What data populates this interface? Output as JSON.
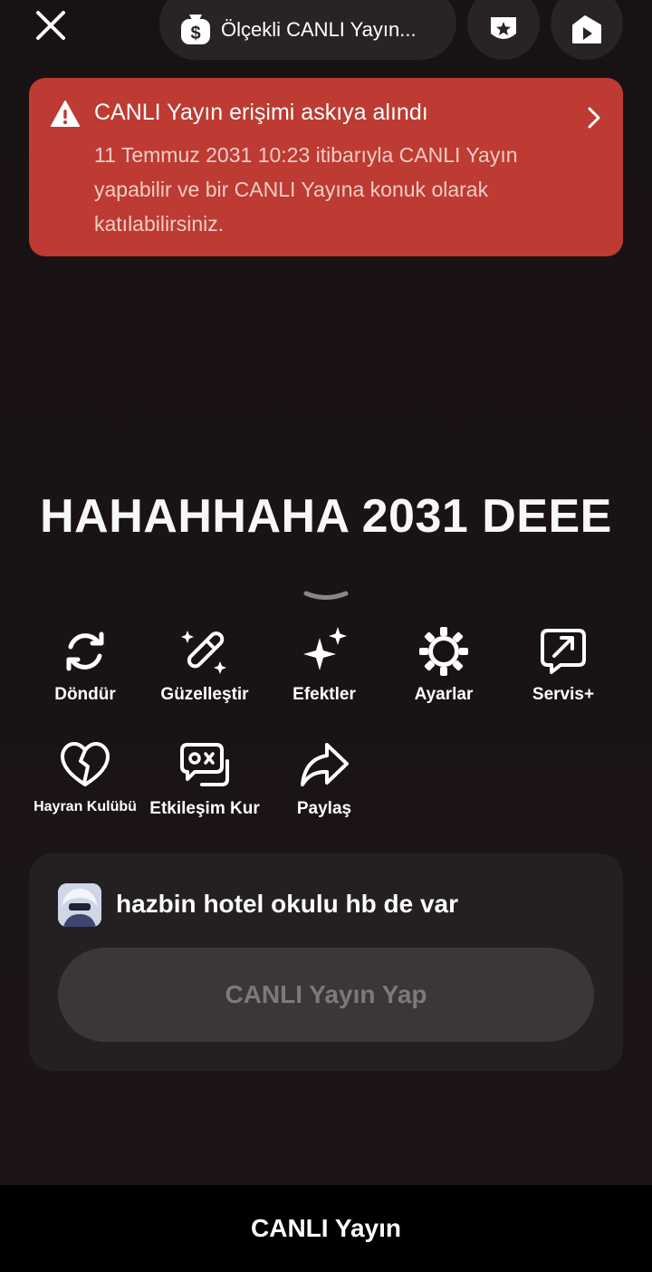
{
  "topbar": {
    "close_icon": "close-icon",
    "pill_icon": "dollar-bag-icon",
    "pill_label": "Ölçekli CANLI Yayın...",
    "badge_icon": "shield-star-icon",
    "video_icon": "video-play-icon"
  },
  "alert": {
    "icon": "warning-icon",
    "title": "CANLI Yayın erişimi askıya alındı",
    "body": "11 Temmuz 2031 10:23 itibarıyla CANLI Yayın yapabilir ve bir CANLI Yayına konuk olarak katılabilirsiniz.",
    "background": "#bd3b32"
  },
  "headline": "HAHAHHAHA 2031 DEEE",
  "tools": {
    "rotate": {
      "label": "Döndür",
      "icon": "rotate-icon"
    },
    "beautify": {
      "label": "Güzelleştir",
      "icon": "magic-wand-icon"
    },
    "effects": {
      "label": "Efektler",
      "icon": "sparkles-icon"
    },
    "settings": {
      "label": "Ayarlar",
      "icon": "gear-icon"
    },
    "service": {
      "label": "Servis+",
      "icon": "service-arrow-icon"
    },
    "fanclub": {
      "label": "Hayran Kulübü",
      "icon": "heart-icon"
    },
    "interact": {
      "label": "Etkileşim Kur",
      "icon": "game-chat-icon"
    },
    "share": {
      "label": "Paylaş",
      "icon": "share-arrow-icon"
    }
  },
  "card": {
    "title": "hazbin hotel okulu hb de var",
    "button_label": "CANLI Yayın Yap"
  },
  "bottom_tab": "CANLI Yayın",
  "colors": {
    "background": "#181214",
    "card": "#242022",
    "button_disabled": "#3b3739",
    "button_text_disabled": "#7d797b"
  }
}
